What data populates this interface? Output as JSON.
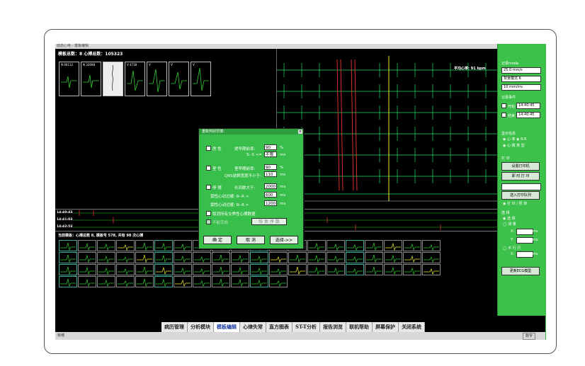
{
  "window": {
    "title": "动态心电 - 模板编辑"
  },
  "left_panel": {
    "header": "模板总数：8  心搏总数：105323",
    "thumbs": [
      {
        "label": "N  90112"
      },
      {
        "label": "N  32698"
      },
      {
        "label": ""
      },
      {
        "label": "V  4718"
      },
      {
        "label": "V"
      },
      {
        "label": "V"
      },
      {
        "label": "V"
      }
    ]
  },
  "right_ecg": {
    "hr": "平均心率: 91 bpm"
  },
  "strips": [
    {
      "time": "14:40:43"
    },
    {
      "time": "14:41:03"
    },
    {
      "time": "14:42:53"
    }
  ],
  "bottom_panel": {
    "header": "当前模板：心搏总数 8, 模板号 578, 共有 98 次心搏"
  },
  "side": {
    "ecg_mode_label": "记录mode",
    "speed": "25.0 mm/s",
    "bg_mode": "背景模式 6",
    "gain": "10 mm/mv",
    "record_event": "记录事件",
    "start_label": "开始",
    "start_time": "14:40:45",
    "end_label": "结束",
    "end_time": "14:40:45",
    "display_label": "显示信息",
    "opt_hr": "心 率",
    "opt_rr": "R-R",
    "opt_mode": "心 搏 类 型",
    "print_label": "打 印",
    "set_print": "设置打印机",
    "print_now": "即 时 打 印",
    "add_queue": "送入打印队列",
    "opt_print": "打 印 / 预 演",
    "select_label": "选 择",
    "opt_sel": "选  择",
    "opt_measure": "测  量",
    "x_label": "X:",
    "y_label": "Y:",
    "unit_ms": "ms",
    "translate_label": "平 行 尺",
    "update_btn": "更新ECG模型"
  },
  "dialog": {
    "title": "重新判别早搏：",
    "cb_room": "房 性",
    "room_prem_label": "提早期前率:",
    "room_prem_val": "90",
    "pct": "%",
    "sd_label": "S--S <=",
    "sd_val": "不限",
    "ms": "ms",
    "cb_vent": "室 性",
    "vent_prem_label": "室早期前率:",
    "vent_prem_val": "90",
    "qrs_label": "QRS波群宽度不小于:",
    "qrs_val": "110",
    "cb_pause": "停 搏",
    "pause_label": "长间歇大于:",
    "pause_val": "2000",
    "brady_label": "窦性心动过缓:  R--R <",
    "brady_val": "600",
    "tachy_label": "窦性心动过缓:  R--R >",
    "tachy_val": "1200",
    "cancel_all": "取消所有交界性心搏数据",
    "disabled_cb": "不能完成",
    "undo_btn": "恢 复 序 数",
    "ok": "确  定",
    "cancel": "取  消",
    "advanced": "选择->>"
  },
  "tabs": [
    "病历管理",
    "分析模块",
    "模板编辑",
    "心律失常",
    "直方图表",
    "ST-T分析",
    "报告浏览",
    "联机帮助",
    "屏幕保护",
    "关闭系统"
  ],
  "active_tab": 2,
  "status_left": "就绪",
  "status_right": "数字"
}
